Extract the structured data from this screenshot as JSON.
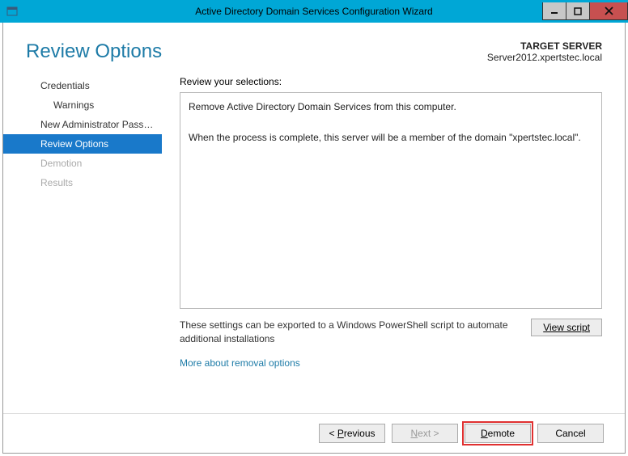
{
  "window": {
    "title": "Active Directory Domain Services Configuration Wizard"
  },
  "header": {
    "page_title": "Review Options",
    "target_label": "TARGET SERVER",
    "target_value": "Server2012.xpertstec.local"
  },
  "sidebar": {
    "items": [
      {
        "label": "Credentials",
        "state": "normal"
      },
      {
        "label": "Warnings",
        "state": "sub"
      },
      {
        "label": "New Administrator Passw...",
        "state": "normal"
      },
      {
        "label": "Review Options",
        "state": "active"
      },
      {
        "label": "Demotion",
        "state": "disabled"
      },
      {
        "label": "Results",
        "state": "disabled"
      }
    ]
  },
  "main": {
    "review_label": "Review your selections:",
    "review_line1": "Remove Active Directory Domain Services from this computer.",
    "review_line2": "When the process is complete, this server will be a member of the domain \"xpertstec.local\".",
    "export_text": "These settings can be exported to a Windows PowerShell script to automate additional installations",
    "view_script": "View script",
    "more_link": "More about removal options"
  },
  "footer": {
    "previous": "< Previous",
    "next": "Next >",
    "demote": "Demote",
    "cancel": "Cancel"
  }
}
